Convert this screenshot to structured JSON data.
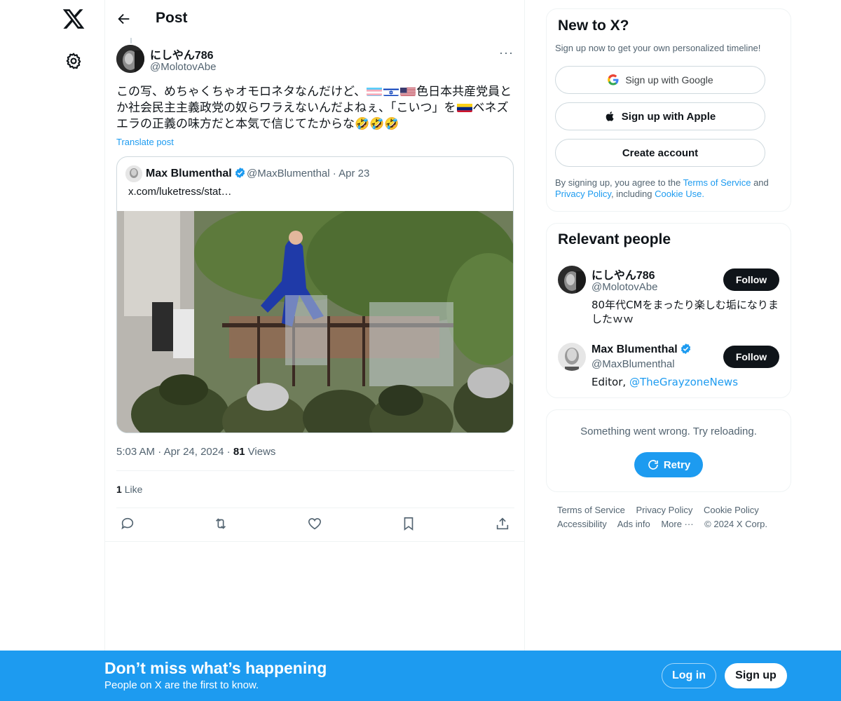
{
  "nav": {
    "logo_icon": "x-logo-icon",
    "settings_icon": "gear-icon"
  },
  "header": {
    "title": "Post"
  },
  "post": {
    "author_name": "にしやん786",
    "author_handle": "@MolotovAbe",
    "text_1": "この写、めちゃくちゃオモロネタなんだけど、",
    "text_2": "色日本共産党員とか社会民主主義政党の奴らワラえないんだよねぇ、「こいつ」を",
    "text_3": "ベネズエラの正義の味方だと本気で信じてたからな🤣🤣🤣",
    "translate_label": "Translate post",
    "quote": {
      "name": "Max Blumenthal",
      "handle": "@MaxBlumenthal",
      "date": "Apr 23",
      "text": "x.com/luketress/stat…"
    },
    "time": "5:03 AM",
    "date": "Apr 24, 2024",
    "views_count": "81",
    "views_label": "Views",
    "likes_count": "1",
    "likes_label": "Like"
  },
  "signup_card": {
    "title": "New to X?",
    "subtitle": "Sign up now to get your own personalized timeline!",
    "google_label": "Sign up with Google",
    "apple_label": "Sign up with Apple",
    "create_label": "Create account",
    "legal_prefix": "By signing up, you agree to the",
    "terms_link": "Terms of Service",
    "legal_and": "and",
    "privacy_link": "Privacy Policy",
    "legal_including": ", including",
    "cookie_link": "Cookie Use."
  },
  "relevant": {
    "title": "Relevant people",
    "people": [
      {
        "name": "にしやん786",
        "handle": "@MolotovAbe",
        "bio": "80年代CMをまったり楽しむ垢になりましたｗｗ",
        "follow_label": "Follow"
      },
      {
        "name": "Max Blumenthal",
        "handle": "@MaxBlumenthal",
        "bio_prefix": "Editor, ",
        "bio_link": "@TheGrayzoneNews",
        "follow_label": "Follow"
      }
    ]
  },
  "error_card": {
    "message": "Something went wrong. Try reloading.",
    "retry_label": "Retry"
  },
  "footer": {
    "terms": "Terms of Service",
    "privacy": "Privacy Policy",
    "cookie": "Cookie Policy",
    "accessibility": "Accessibility",
    "ads": "Ads info",
    "more": "More ···",
    "copyright": "© 2024 X Corp."
  },
  "banner": {
    "title": "Don’t miss what’s happening",
    "subtitle": "People on X are the first to know.",
    "login_label": "Log in",
    "signup_label": "Sign up"
  },
  "colors": {
    "accent": "#1d9bf0",
    "text": "#0f1419",
    "muted": "#536471",
    "border": "#eff3f4"
  }
}
